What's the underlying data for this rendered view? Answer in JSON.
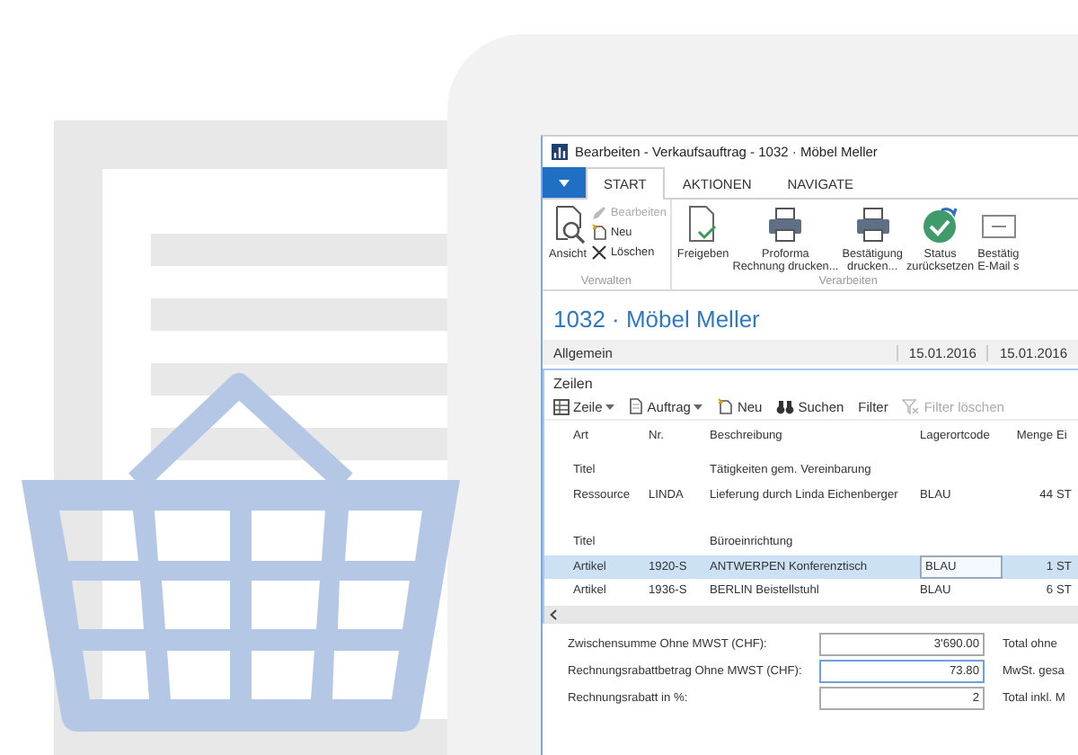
{
  "window": {
    "title": "Bearbeiten - Verkaufsauftrag - 1032 · Möbel Meller",
    "ribbon": {
      "tabs": [
        {
          "label": "START",
          "selected": true
        },
        {
          "label": "AKTIONEN",
          "selected": false
        },
        {
          "label": "NAVIGATE",
          "selected": false
        }
      ],
      "groups": [
        {
          "label": "Verwalten",
          "large_buttons": [
            {
              "lines": [
                "Ansicht"
              ],
              "kind": "view"
            }
          ],
          "small_buttons": [
            {
              "label": "Bearbeiten",
              "kind": "pencil",
              "disabled": true
            },
            {
              "label": "Neu",
              "kind": "new",
              "disabled": false
            },
            {
              "label": "Löschen",
              "kind": "delete",
              "disabled": false
            }
          ]
        },
        {
          "label": "Verarbeiten",
          "large_buttons": [
            {
              "lines": [
                "Freigeben"
              ],
              "kind": "release"
            },
            {
              "lines": [
                "Proforma",
                "Rechnung drucken..."
              ],
              "kind": "print"
            },
            {
              "lines": [
                "Bestätigung",
                "drucken..."
              ],
              "kind": "print"
            },
            {
              "lines": [
                "Status",
                "zurücksetzen"
              ],
              "kind": "status"
            },
            {
              "lines": [
                "Bestätig",
                "E-Mail s"
              ],
              "kind": "mail"
            }
          ]
        }
      ]
    },
    "page_title": "1032 · Möbel Meller",
    "general": {
      "label": "Allgemein",
      "dates": [
        "15.01.2016",
        "15.01.2016"
      ]
    },
    "lines_section": {
      "title": "Zeilen",
      "toolbar": [
        {
          "label": "Zeile",
          "kind": "grid",
          "dropdown": true,
          "disabled": false
        },
        {
          "label": "Auftrag",
          "kind": "doc",
          "dropdown": true,
          "disabled": false
        },
        {
          "label": "Neu",
          "kind": "new",
          "dropdown": false,
          "disabled": false
        },
        {
          "label": "Suchen",
          "kind": "binoculars",
          "dropdown": false,
          "disabled": false
        },
        {
          "label": "Filter",
          "kind": "plain",
          "dropdown": false,
          "disabled": false
        },
        {
          "label": "Filter löschen",
          "kind": "clear-filter",
          "dropdown": false,
          "disabled": true
        }
      ],
      "columns": [
        "Art",
        "Nr.",
        "Beschreibung",
        "Lagerortcode",
        "Menge",
        "Ei"
      ],
      "rows": [
        {
          "kind": "line",
          "art": "Titel",
          "beschreibung": "Tätigkeiten gem. Vereinbarung",
          "selected": false
        },
        {
          "kind": "line",
          "art": "Ressource",
          "nr": "LINDA",
          "beschreibung": "Lieferung durch Linda Eichenberger",
          "lagerortcode": "BLAU",
          "menge": "44",
          "einheit": "ST",
          "selected": false
        },
        {
          "kind": "spacer"
        },
        {
          "kind": "line",
          "art": "Titel",
          "beschreibung": "Büroeinrichtung",
          "selected": false
        },
        {
          "kind": "line",
          "art": "Artikel",
          "nr": "1920-S",
          "beschreibung": "ANTWERPEN Konferenztisch",
          "lagerortcode": "BLAU",
          "menge": "1",
          "einheit": "ST",
          "selected": true
        },
        {
          "kind": "line",
          "art": "Artikel",
          "nr": "1936-S",
          "beschreibung": "BERLIN Beistellstuhl",
          "lagerortcode": "BLAU",
          "menge": "6",
          "einheit": "ST",
          "selected": false
        }
      ]
    },
    "totals": {
      "fields": [
        {
          "label": "Zwischensumme Ohne MWST (CHF):",
          "value": "3'690.00",
          "focused": false
        },
        {
          "label": "Rechnungsrabattbetrag Ohne MWST (CHF):",
          "value": "73.80",
          "focused": true
        },
        {
          "label": "Rechnungsrabatt in %:",
          "value": "2",
          "focused": false
        }
      ],
      "right_labels": [
        "Total ohne",
        "MwSt. gesa",
        "Total inkl. M"
      ]
    }
  }
}
